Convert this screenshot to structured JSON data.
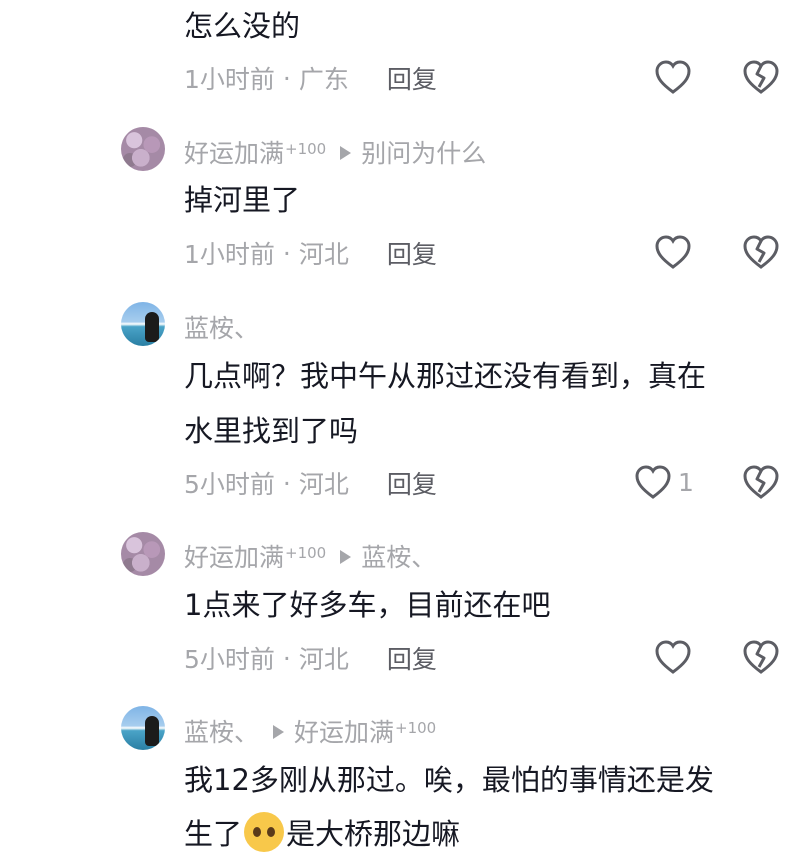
{
  "comments": [
    {
      "text_lines": [
        "怎么没的"
      ],
      "time": "1小时前",
      "location": "广东",
      "reply_label": "回复",
      "like_count": ""
    },
    {
      "author": "好运加满",
      "author_badge": "+100",
      "reply_to": "别问为什么",
      "text_lines": [
        "掉河里了"
      ],
      "time": "1小时前",
      "location": "河北",
      "reply_label": "回复",
      "like_count": ""
    },
    {
      "author": "蓝桉、",
      "text_lines": [
        "几点啊？我中午从那过还没有看到，真在",
        "水里找到了吗"
      ],
      "time": "5小时前",
      "location": "河北",
      "reply_label": "回复",
      "like_count": "1"
    },
    {
      "author": "好运加满",
      "author_badge": "+100",
      "reply_to": "蓝桉、",
      "text_lines": [
        "1点来了好多车，目前还在吧"
      ],
      "time": "5小时前",
      "location": "河北",
      "reply_label": "回复",
      "like_count": ""
    },
    {
      "author": "蓝桉、",
      "reply_to": "好运加满",
      "reply_to_badge": "+100",
      "text_lines": [
        "我12多刚从那过。唉，最怕的事情还是发"
      ],
      "text_line2_before": "生了",
      "emoji_name": "pleading-face-emoji",
      "text_line2_after": "是大桥那边嘛"
    }
  ],
  "separator": "·"
}
